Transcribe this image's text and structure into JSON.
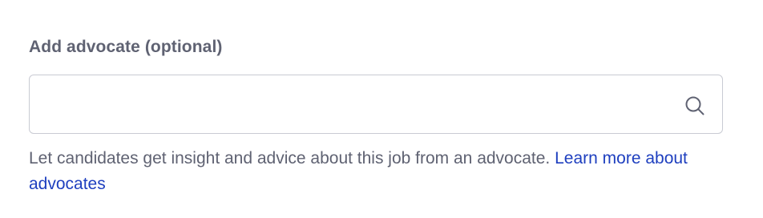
{
  "advocate_field": {
    "label": "Add advocate (optional)",
    "value": "",
    "placeholder": "",
    "icon": "search-icon"
  },
  "helper": {
    "text": "Let candidates get insight and advice about this job from an advocate. ",
    "link_text": "Learn more about advocates"
  },
  "colors": {
    "label_text": "#5f6272",
    "input_border": "#c9cbd3",
    "link": "#1e3fbf",
    "icon": "#5f6272"
  }
}
